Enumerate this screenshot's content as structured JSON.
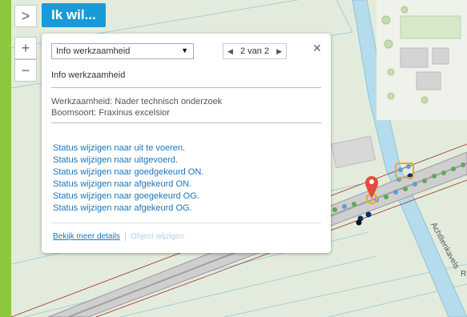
{
  "map": {
    "road_label": "Achtlienkavels",
    "road_label_extra": "R",
    "pin_color": "#e64a3c"
  },
  "controls": {
    "toggle_symbol": ">",
    "zoom_in_symbol": "+",
    "zoom_out_symbol": "−",
    "ik_wil_label": "Ik wil..."
  },
  "popup": {
    "select_value": "Info werkzaamheid",
    "pager_prev": "◀",
    "pager_text": "2 van 2",
    "pager_next": "▶",
    "close_symbol": "✕",
    "heading": "Info werkzaamheid",
    "details": [
      "Werkzaamheid: Nader technisch onderzoek",
      "Boomsoort: Fraxinus excelsior"
    ],
    "actions": [
      "Status wijzigen naar uit te voeren.",
      "Status wijzigen naar uitgevoerd.",
      "Status wijzigen naar goedgekeurd ON.",
      "Status wijzigen naar afgekeurd ON.",
      "Status wijzigen naar goegekeurd OG.",
      "Status wijzigen naar afgekeurd OG."
    ],
    "more_details": "Bekijk meer details",
    "edit_object": "Object wijzigen"
  }
}
